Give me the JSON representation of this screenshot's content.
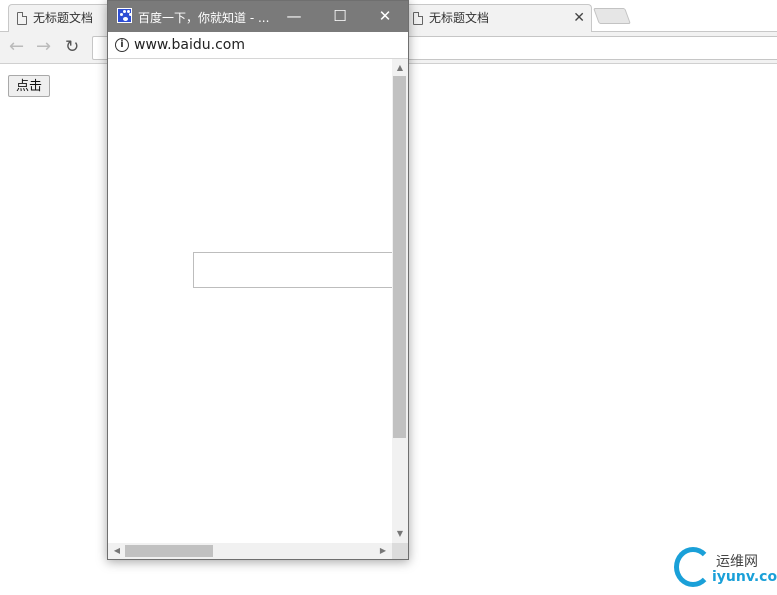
{
  "background_browser": {
    "tabs": [
      {
        "label": "无标题文档"
      },
      {
        "label": "无标题文档",
        "close": "✕"
      }
    ],
    "nav": {
      "back": "←",
      "forward": "→",
      "reload": "↻"
    }
  },
  "page": {
    "button_label": "点击"
  },
  "popup": {
    "title": "百度一下，你就知道 - ...",
    "controls": {
      "minimize": "—",
      "maximize": "☐",
      "close": "✕"
    },
    "url": "www.baidu.com",
    "info_glyph": "i",
    "scroll_up": "▲",
    "scroll_down": "▼",
    "scroll_left": "◀",
    "scroll_right": "▶",
    "favicon_color": "#2e4ed4"
  },
  "watermark": {
    "cn": "运维网",
    "en": "iyunv.com",
    "color": "#1aa0d8"
  }
}
